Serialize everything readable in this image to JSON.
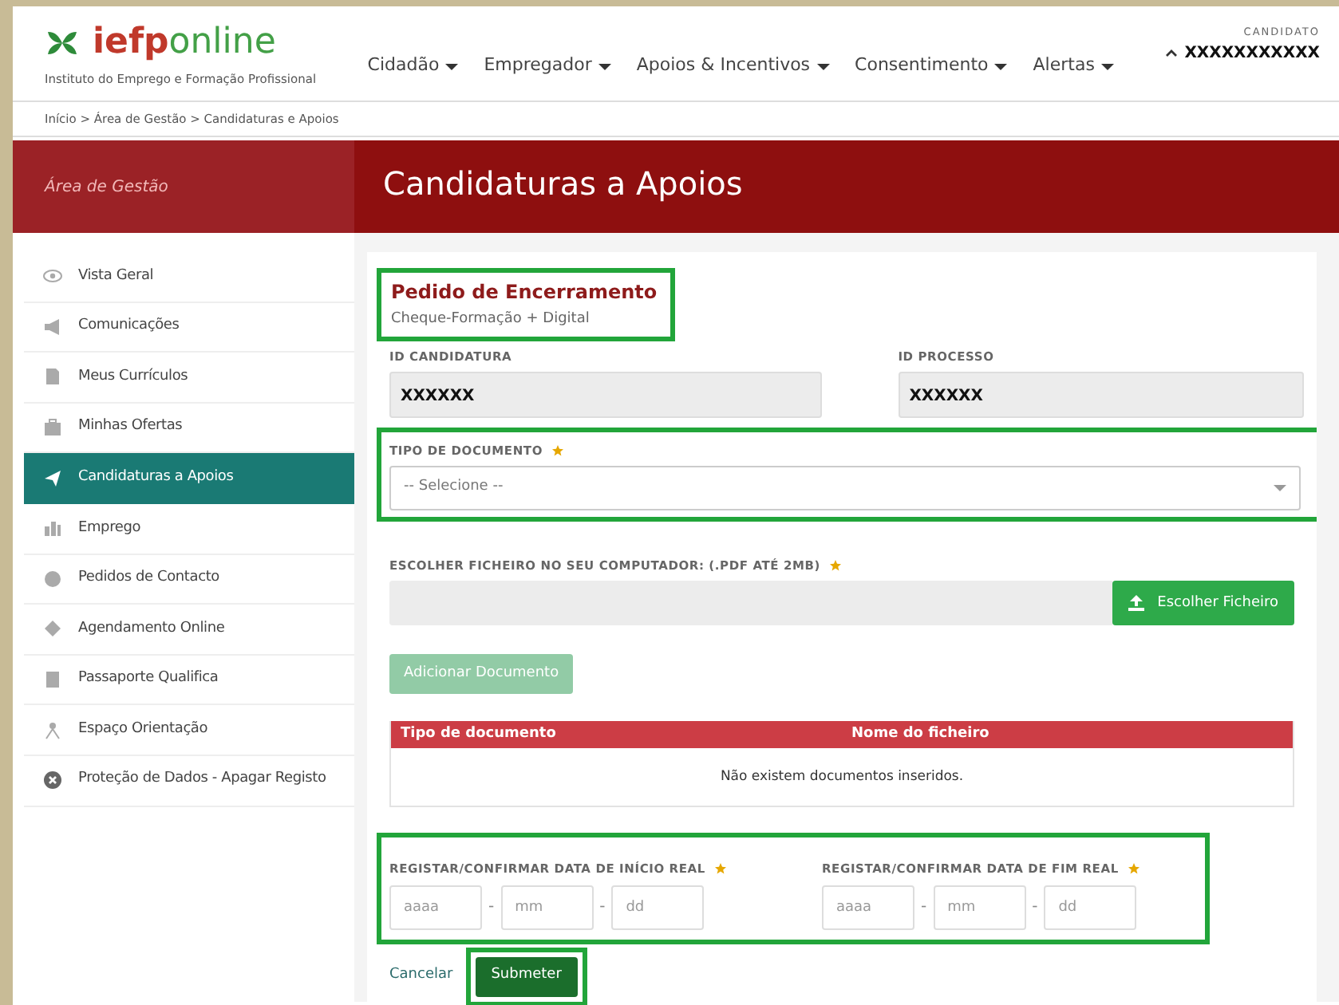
{
  "logo": {
    "brand_bold": "iefp",
    "brand_light": "online",
    "subtitle": "Instituto do Emprego e Formação Profissional"
  },
  "nav": [
    {
      "label": "Cidadão"
    },
    {
      "label": "Empregador"
    },
    {
      "label": "Apoios & Incentivos"
    },
    {
      "label": "Consentimento"
    },
    {
      "label": "Alertas"
    }
  ],
  "user": {
    "role": "CANDIDATO",
    "name": "XXXXXXXXXXX"
  },
  "breadcrumb": "Início > Área de Gestão > Candidaturas e Apoios",
  "sidebar": {
    "title": "Área de Gestão",
    "items": [
      {
        "label": "Vista Geral",
        "selected": false
      },
      {
        "label": "Comunicações",
        "selected": false
      },
      {
        "label": "Meus Currículos",
        "selected": false
      },
      {
        "label": "Minhas Ofertas",
        "selected": false
      },
      {
        "label": "Candidaturas a Apoios",
        "selected": true
      },
      {
        "label": "Emprego",
        "selected": false
      },
      {
        "label": "Pedidos de Contacto",
        "selected": false
      },
      {
        "label": "Agendamento Online",
        "selected": false
      },
      {
        "label": "Passaporte Qualifica",
        "selected": false
      },
      {
        "label": "Espaço Orientação",
        "selected": false
      },
      {
        "label": "Proteção de Dados - Apagar Registo",
        "selected": false
      }
    ]
  },
  "page_title": "Candidaturas a Apoios",
  "form": {
    "title": "Pedido de Encerramento",
    "subtitle": "Cheque-Formação + Digital",
    "ids": [
      {
        "label": "ID CANDIDATURA",
        "value": "XXXXXX"
      },
      {
        "label": "ID PROCESSO",
        "value": "XXXXXX"
      }
    ],
    "doc_type": {
      "label": "TIPO DE DOCUMENTO",
      "required": true,
      "placeholder": "-- Selecione --"
    },
    "file": {
      "label": "ESCOLHER FICHEIRO NO SEU COMPUTADOR: (.PDF ATÉ 2MB)",
      "required": true,
      "button": "Escolher Ficheiro"
    },
    "add_button": {
      "label": "Adicionar Documento",
      "disabled": true
    },
    "table": {
      "columns": [
        "Tipo de documento",
        "Nome do ficheiro"
      ],
      "empty": "Não existem documentos inseridos."
    },
    "dates": [
      {
        "label": "REGISTAR/CONFIRMAR DATA DE INÍCIO REAL",
        "required": true,
        "parts": [
          {
            "placeholder": "aaaa"
          },
          {
            "placeholder": "mm"
          },
          {
            "placeholder": "dd"
          }
        ],
        "separator": "-"
      },
      {
        "label": "REGISTAR/CONFIRMAR DATA DE FIM REAL",
        "required": true,
        "parts": [
          {
            "placeholder": "aaaa"
          },
          {
            "placeholder": "mm"
          },
          {
            "placeholder": "dd"
          }
        ],
        "separator": "-"
      }
    ],
    "cancel": "Cancelar",
    "submit": "Submeter"
  }
}
